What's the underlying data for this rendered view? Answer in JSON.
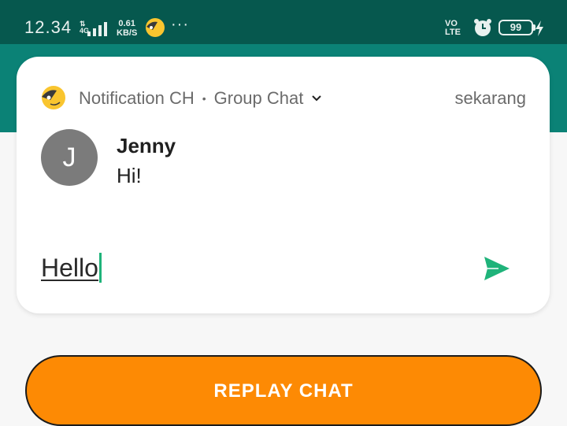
{
  "status_bar": {
    "time": "12.34",
    "network_type": "4G",
    "speed_value": "0.61",
    "speed_unit": "KB/S",
    "more": "···",
    "volte_top": "VO",
    "volte_bottom": "LTE",
    "battery": "99"
  },
  "notification": {
    "channel": "Notification CH",
    "separator": "•",
    "group": "Group Chat",
    "time": "sekarang",
    "sender_initial": "J",
    "sender_name": "Jenny",
    "message": "Hi!",
    "reply_text": "Hello",
    "accent_color": "#1fb37a"
  },
  "actions": {
    "replay_label": "REPLAY CHAT"
  },
  "colors": {
    "status_bar": "#06584e",
    "app_bar": "#0b8276",
    "button": "#fd8a04"
  }
}
